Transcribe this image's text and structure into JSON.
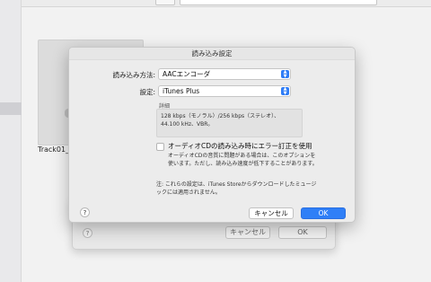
{
  "background": {
    "track_label": "Track01_I"
  },
  "back_dialog": {
    "help_label": "?",
    "cancel_label": "キャンセル",
    "ok_label": "OK"
  },
  "dialog": {
    "title": "読み込み設定",
    "import_method": {
      "label": "読み込み方法:",
      "value": "AACエンコーダ"
    },
    "setting": {
      "label": "設定:",
      "value": "iTunes Plus"
    },
    "details": {
      "title": "詳細",
      "text": "128 kbps（モノラル）/256 kbps（ステレオ）、44.100 kHz、VBR。"
    },
    "error_correction": {
      "label": "オーディオCDの読み込み時にエラー訂正を使用",
      "checked": false,
      "description": "オーディオCDの音質に問題がある場合は、このオプションを使います。ただし、読み込み速度が低下することがあります。"
    },
    "note": "注: これらの設定は、iTunes Storeからダウンロードしたミュージックには適用されません。",
    "help_label": "?",
    "cancel_label": "キャンセル",
    "ok_label": "OK"
  },
  "colors": {
    "accent": "#2f7ff7",
    "dialog_bg": "#ececec"
  }
}
